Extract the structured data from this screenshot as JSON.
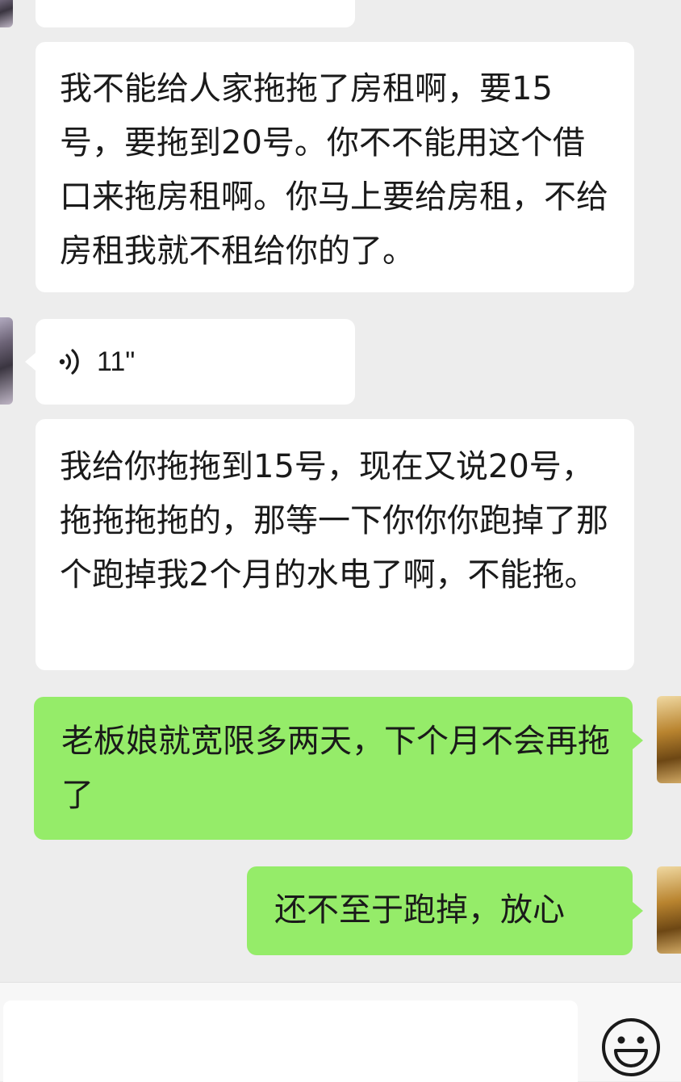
{
  "conversation": {
    "messages": [
      {
        "id": "m0",
        "direction": "incoming",
        "type": "text",
        "text": ""
      },
      {
        "id": "m1",
        "direction": "incoming",
        "type": "text",
        "text": "我不能给人家拖拖了房租啊，要15号，要拖到20号。你不不能用这个借口来拖房租啊。你马上要给房租，不给房租我就不租给你的了。"
      },
      {
        "id": "m2",
        "direction": "incoming",
        "type": "voice",
        "duration": "11\""
      },
      {
        "id": "m3",
        "direction": "incoming",
        "type": "text",
        "text": "我给你拖拖到15号，现在又说20号，拖拖拖拖的，那等一下你你你跑掉了那个跑掉我2个月的水电了啊，不能拖。"
      },
      {
        "id": "m4",
        "direction": "outgoing",
        "type": "text",
        "text": "老板娘就宽限多两天，下个月不会再拖了"
      },
      {
        "id": "m5",
        "direction": "outgoing",
        "type": "text",
        "text": "还不至于跑掉，放心"
      }
    ]
  },
  "input_bar": {
    "input_value": "",
    "emoji_icon": "smiley-face-icon"
  },
  "colors": {
    "background": "#ededed",
    "incoming_bubble": "#ffffff",
    "outgoing_bubble": "#95ec69",
    "text": "#1a1a1a"
  }
}
